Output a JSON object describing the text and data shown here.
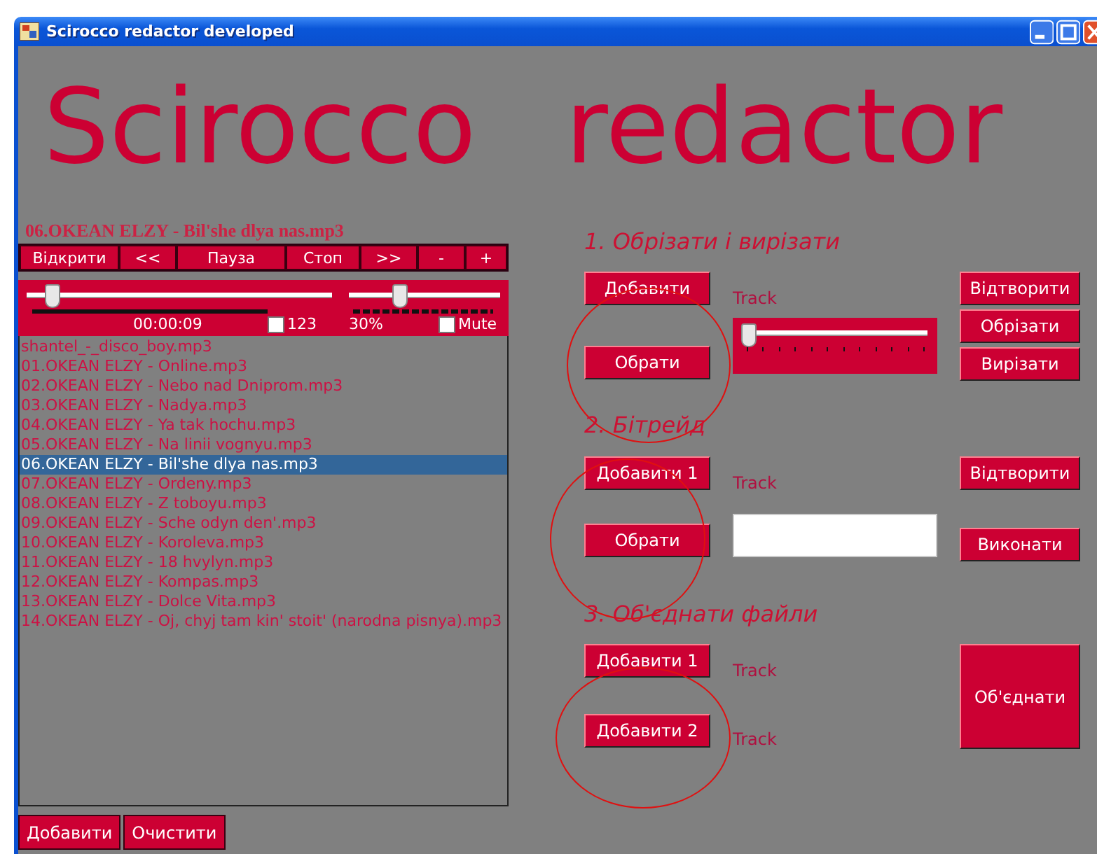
{
  "window": {
    "title": "Scirocco redactor developed"
  },
  "app_title": "Scirocco redactor",
  "player": {
    "now_playing": "06.OKEAN ELZY - Bil'she dlya nas.mp3",
    "toolbar": [
      "Відкрити",
      "<<",
      "Пауза",
      "Стоп",
      ">>",
      "-",
      "+"
    ],
    "seek": {
      "level": 0.06
    },
    "time": "00:00:09",
    "loop": {
      "label": "123",
      "checked": false
    },
    "volume": {
      "level": 0.3,
      "reading": "30%"
    },
    "mute": {
      "label": "Mute",
      "checked": false
    }
  },
  "playlist": [
    {
      "name": "shantel_-_disco_boy.mp3",
      "selected": false
    },
    {
      "name": "01.OKEAN ELZY - Online.mp3",
      "selected": false
    },
    {
      "name": "02.OKEAN ELZY - Nebo nad Dniprom.mp3",
      "selected": false
    },
    {
      "name": "03.OKEAN ELZY - Nadya.mp3",
      "selected": false
    },
    {
      "name": "04.OKEAN ELZY - Ya tak hochu.mp3",
      "selected": false
    },
    {
      "name": "05.OKEAN ELZY - Na linii vognyu.mp3",
      "selected": false
    },
    {
      "name": "06.OKEAN ELZY - Bil'she dlya nas.mp3",
      "selected": true
    },
    {
      "name": "07.OKEAN ELZY - Ordeny.mp3",
      "selected": false
    },
    {
      "name": "08.OKEAN ELZY - Z toboyu.mp3",
      "selected": false
    },
    {
      "name": "09.OKEAN ELZY - Sche odyn den'.mp3",
      "selected": false
    },
    {
      "name": "10.OKEAN ELZY - Koroleva.mp3",
      "selected": false
    },
    {
      "name": "11.OKEAN ELZY - 18 hvylyn.mp3",
      "selected": false
    },
    {
      "name": "12.OKEAN ELZY - Kompas.mp3",
      "selected": false
    },
    {
      "name": "13.OKEAN ELZY - Dolce Vita.mp3",
      "selected": false
    },
    {
      "name": "14.OKEAN ELZY - Oj, chyj tam kin' stoit' (narodna pisnya).mp3",
      "selected": false
    }
  ],
  "playlist_buttons": [
    "Добавити",
    "Очистити"
  ],
  "cut": {
    "heading": "1. Обрізати і вирізати",
    "add_button": "Добавити",
    "choose_button": "Обрати",
    "track_label": "Track",
    "track_slider": {
      "level": 0
    },
    "actions": [
      "Відтворити",
      "Обрізати",
      "Вирізати"
    ]
  },
  "bitrate": {
    "heading": "2. Бітрейд",
    "add_button": "Добавити 1",
    "choose_button": "Обрати",
    "track_label": "Track",
    "actions": [
      "Відтворити",
      "Виконати"
    ]
  },
  "merge": {
    "heading": "3. Об'єднати файли",
    "add_buttons": [
      "Добавити 1",
      "Добавити 2"
    ],
    "track_labels": [
      "Track",
      "Track"
    ],
    "merge_button": "Об'єднати"
  }
}
